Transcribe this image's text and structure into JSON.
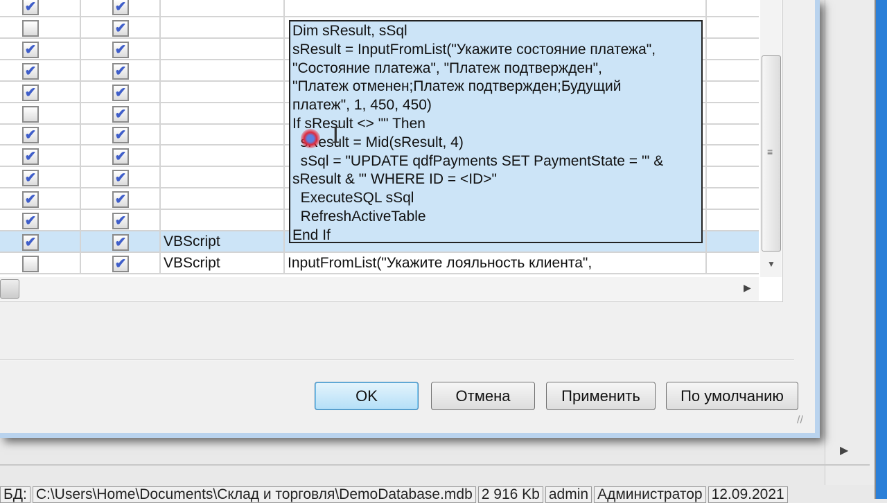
{
  "grid": {
    "rows": [
      {
        "c0": true,
        "c1": true,
        "type": "",
        "code": ""
      },
      {
        "c0": false,
        "c1": true,
        "type": "",
        "code": ""
      },
      {
        "c0": true,
        "c1": true,
        "type": "",
        "code": ""
      },
      {
        "c0": true,
        "c1": true,
        "type": "",
        "code": ""
      },
      {
        "c0": true,
        "c1": true,
        "type": "",
        "code": ""
      },
      {
        "c0": false,
        "c1": true,
        "type": "",
        "code": ""
      },
      {
        "c0": true,
        "c1": true,
        "type": "",
        "code": ""
      },
      {
        "c0": true,
        "c1": true,
        "type": "",
        "code": ""
      },
      {
        "c0": true,
        "c1": true,
        "type": "",
        "code": ""
      },
      {
        "c0": true,
        "c1": true,
        "type": "",
        "code": ""
      },
      {
        "c0": true,
        "c1": true,
        "type": "",
        "code": ""
      },
      {
        "c0": true,
        "c1": true,
        "type": "VBScript",
        "code": "",
        "selected": true
      },
      {
        "c0": false,
        "c1": true,
        "type": "VBScript",
        "code": "InputFromList(\"Укажите лояльность клиента\","
      }
    ]
  },
  "editor": {
    "text": "Dim sResult, sSql\nsResult = InputFromList(\"Укажите состояние платежа\",\n\"Состояние платежа\", \"Платеж подтвержден\",\n\"Платеж отменен;Платеж подтвержден;Будущий\nплатеж\", 1, 450, 450)\nIf sResult <> \"\" Then\n  sResult = Mid(sResult, 4)\n  sSql = \"UPDATE qdfPayments SET PaymentState = '\" &\nsResult & \"' WHERE ID = <ID>\"\n  ExecuteSQL sSql\n  RefreshActiveTable\nEnd If"
  },
  "buttons": {
    "ok": "OK",
    "cancel": "Отмена",
    "apply": "Применить",
    "default": "По умолчанию"
  },
  "status": {
    "db_label": "БД:",
    "path": "C:\\Users\\Home\\Documents\\Склад и торговля\\DemoDatabase.mdb",
    "size": "2 916 Kb",
    "user": "admin",
    "role": "Администратор",
    "date": "12.09.2021"
  },
  "colors": {
    "selection": "#cce4f7",
    "accent": "#2a7fd8"
  }
}
